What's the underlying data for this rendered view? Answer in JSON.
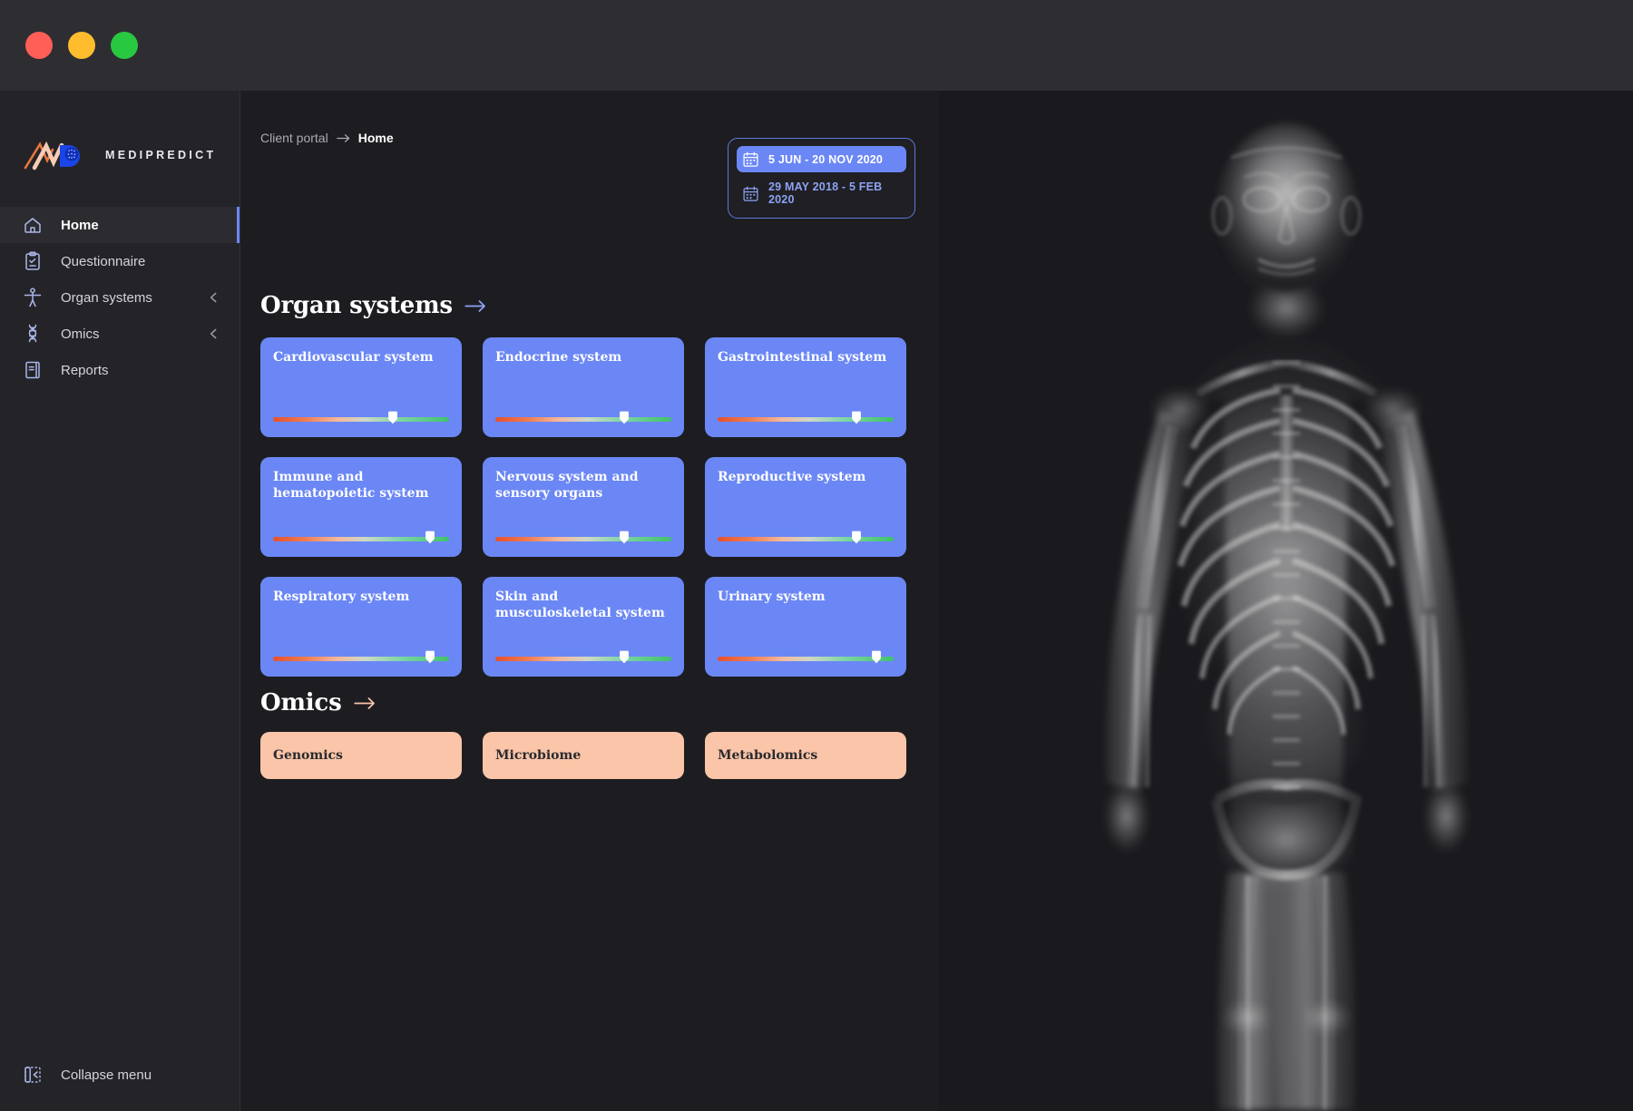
{
  "window": {
    "dots": [
      {
        "name": "close",
        "color": "#ff5f57"
      },
      {
        "name": "minimize",
        "color": "#ffbd2e"
      },
      {
        "name": "maximize",
        "color": "#28c840"
      }
    ]
  },
  "brand": {
    "name": "MEDIPREDICT"
  },
  "sidebar": {
    "items": [
      {
        "label": "Home",
        "icon": "home-icon",
        "active": true,
        "expandable": false
      },
      {
        "label": "Questionnaire",
        "icon": "clipboard-check-icon",
        "active": false,
        "expandable": false
      },
      {
        "label": "Organ systems",
        "icon": "body-figure-icon",
        "active": false,
        "expandable": true
      },
      {
        "label": "Omics",
        "icon": "dna-helix-icon",
        "active": false,
        "expandable": true
      },
      {
        "label": "Reports",
        "icon": "book-icon",
        "active": false,
        "expandable": false
      }
    ],
    "collapse_label": "Collapse menu"
  },
  "breadcrumb": {
    "parent": "Client portal",
    "current": "Home"
  },
  "datepicker": {
    "ranges": [
      {
        "label": "5 JUN - 20 NOV 2020",
        "selected": true
      },
      {
        "label": "29 MAY 2018 - 5 FEB 2020",
        "selected": false
      }
    ]
  },
  "organ_section": {
    "title": "Organ systems",
    "cards": [
      {
        "title": "Cardiovascular system",
        "value": 68
      },
      {
        "title": "Endocrine system",
        "value": 73
      },
      {
        "title": "Gastrointestinal system",
        "value": 79
      },
      {
        "title": "Immune and hematopoietic system",
        "value": 89
      },
      {
        "title": "Nervous system and sensory organs",
        "value": 73
      },
      {
        "title": "Reproductive system",
        "value": 79
      },
      {
        "title": "Respiratory system",
        "value": 89
      },
      {
        "title": "Skin and musculoskeletal system",
        "value": 73
      },
      {
        "title": "Urinary system",
        "value": 90
      }
    ]
  },
  "omics_section": {
    "title": "Omics",
    "cards": [
      {
        "title": "Genomics"
      },
      {
        "title": "Microbiome"
      },
      {
        "title": "Metabolomics"
      }
    ]
  },
  "colors": {
    "accent_blue": "#6b87f5",
    "omics_peach": "#fac5a8",
    "background": "#1d1d21",
    "sidebar": "#242428",
    "titlebar": "#2e2e32"
  },
  "illustration": {
    "name": "xray-human-body-anatomy"
  }
}
